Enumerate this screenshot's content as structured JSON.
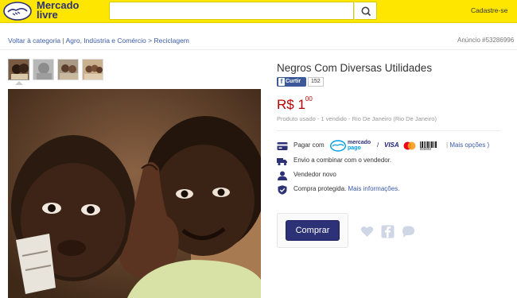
{
  "header": {
    "logo_line1": "Mercado",
    "logo_line2": "livre",
    "search_placeholder": "",
    "signup_label": "Cadastre-se"
  },
  "breadcrumb": {
    "back_label": "Voltar à categoria",
    "path": [
      "Agro, Indústria e Comércio",
      "Reciclagem"
    ],
    "separator": ">"
  },
  "ad_number": "Anúncio #53286996",
  "gallery": {
    "thumbnail_count": 4,
    "active_index": 0
  },
  "product": {
    "title": "Negros Com Diversas Utilidades",
    "facebook_like_label": "Curtir",
    "facebook_like_count": "152",
    "price_currency": "R$ 1",
    "price_cents": "00",
    "meta": "Produto usado - 1 vendido - Rio De Janeiro (Rio De Janeiro)"
  },
  "details": {
    "payment_label": "Pagar com",
    "mercadopago_line1": "mercado",
    "mercadopago_line2": "pago",
    "card_separator": "/",
    "visa_label": "VISA",
    "boleto_label": "Boleto",
    "more_options": "Mais opções )",
    "more_options_open": "|",
    "shipping": "Envio a combinar com o vendedor.",
    "seller": "Vendedor novo",
    "protected": "Compra protegida.",
    "more_info": "Mais informações."
  },
  "actions": {
    "buy_label": "Comprar"
  },
  "colors": {
    "header_bg": "#ffe600",
    "brand_blue": "#2d3277",
    "price_red": "#b80000",
    "link_blue": "#3a5aa6",
    "facebook_blue": "#3b5998"
  }
}
